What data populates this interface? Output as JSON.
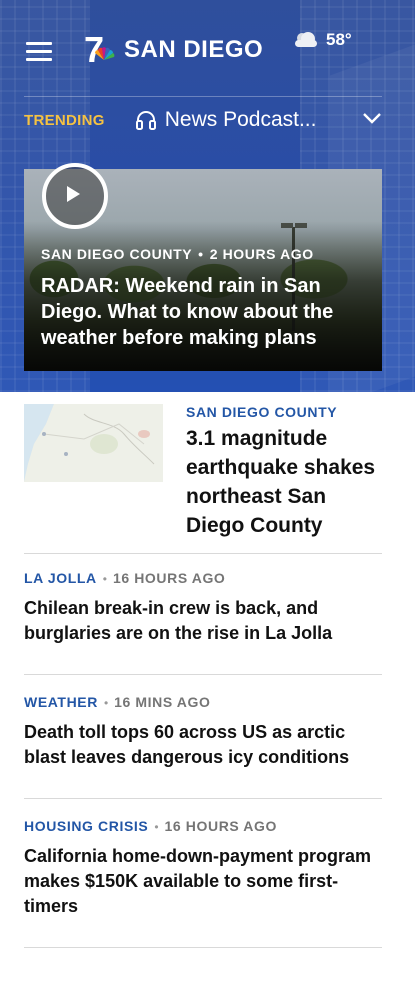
{
  "header": {
    "logo_text": "SAN DIEGO",
    "temperature": "58°",
    "weather_icon": "partly-cloudy-icon"
  },
  "trending": {
    "label": "TRENDING",
    "link": "News Podcast..."
  },
  "feature": {
    "category": "SAN DIEGO COUNTY",
    "time": "2 HOURS AGO",
    "title": "RADAR: Weekend rain in San Diego. What to know about the weather before making plans"
  },
  "lead_story": {
    "category": "SAN DIEGO COUNTY",
    "title": "3.1 magnitude earthquake shakes northeast San Diego County"
  },
  "stories": [
    {
      "category": "LA JOLLA",
      "time": "16 HOURS AGO",
      "title": "Chilean break-in crew is back, and burglaries are on the rise in La Jolla"
    },
    {
      "category": "WEATHER",
      "time": "16 MINS AGO",
      "title": "Death toll tops 60 across US as arctic blast leaves dangerous icy conditions"
    },
    {
      "category": "HOUSING CRISIS",
      "time": "16 HOURS AGO",
      "title": "California home-down-payment program makes $150K available to some first-timers"
    }
  ],
  "colors": {
    "header_bg": "#2a4da6",
    "trending_label": "#f5c242",
    "category_link": "#2356a6"
  }
}
